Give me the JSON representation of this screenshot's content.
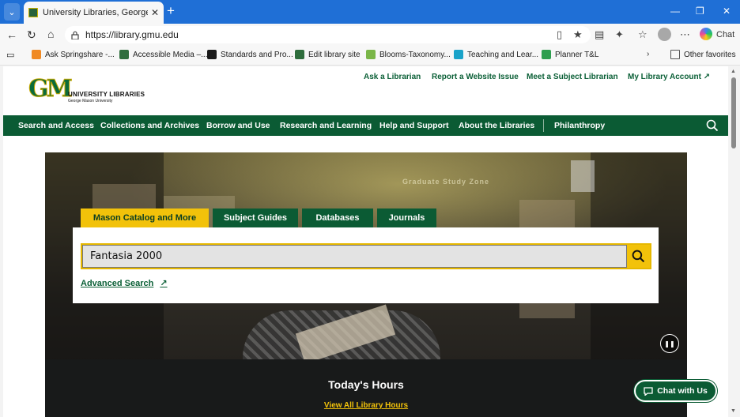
{
  "browser": {
    "tab_title": "University Libraries, George Mason",
    "url": "https://library.gmu.edu",
    "chat_label": "Chat",
    "favorites": [
      {
        "label": "Ask Springshare -...",
        "color": "#f08a24"
      },
      {
        "label": "Accessible Media –...",
        "color": "#2f6e3d"
      },
      {
        "label": "Standards and Pro...",
        "color": "#1a1a1a"
      },
      {
        "label": "Edit library site",
        "color": "#2f6e3d"
      },
      {
        "label": "Blooms-Taxonomy...",
        "color": "#7ab648"
      },
      {
        "label": "Teaching and Lear...",
        "color": "#1aa3c9"
      },
      {
        "label": "Planner T&L",
        "color": "#2e9e4f"
      }
    ],
    "other_favorites": "Other favorites"
  },
  "site": {
    "logo": {
      "mark": "GM",
      "name": "UNIVERSITY LIBRARIES",
      "sub": "George Mason University"
    },
    "utility_links": [
      "Ask a Librarian",
      "Report a Website Issue",
      "Meet a Subject Librarian",
      "My Library Account ↗"
    ],
    "nav": [
      "Search and Access",
      "Collections and Archives",
      "Borrow and Use",
      "Research and Learning",
      "Help and Support",
      "About the Libraries",
      "Philanthropy"
    ],
    "hero_sign": "Graduate Study Zone",
    "search": {
      "tabs": [
        "Mason Catalog and More",
        "Subject Guides",
        "Databases",
        "Journals"
      ],
      "active_tab": 0,
      "query": "Fantasia 2000",
      "advanced": "Advanced Search"
    },
    "hours": {
      "title": "Today's Hours",
      "link": "View All Library Hours"
    },
    "chat_button": "Chat with Us"
  },
  "colors": {
    "brand_green": "#0b5b34",
    "brand_gold": "#f2c20a",
    "browser_blue": "#1f6fd6"
  }
}
